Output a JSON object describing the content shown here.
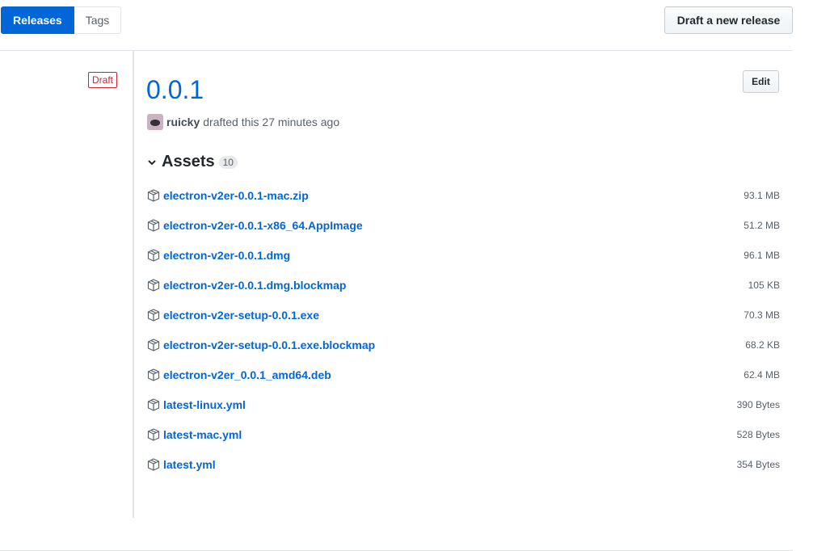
{
  "subnav": {
    "releases": "Releases",
    "tags": "Tags"
  },
  "actions": {
    "draft_new_release": "Draft a new release",
    "edit": "Edit"
  },
  "release": {
    "status_label": "Draft",
    "title": "0.0.1",
    "author": "ruicky",
    "meta_text": "drafted this 27 minutes ago"
  },
  "assets": {
    "title": "Assets",
    "count": "10",
    "items": [
      {
        "name": "electron-v2er-0.0.1-mac.zip",
        "size": "93.1 MB"
      },
      {
        "name": "electron-v2er-0.0.1-x86_64.AppImage",
        "size": "51.2 MB"
      },
      {
        "name": "electron-v2er-0.0.1.dmg",
        "size": "96.1 MB"
      },
      {
        "name": "electron-v2er-0.0.1.dmg.blockmap",
        "size": "105 KB"
      },
      {
        "name": "electron-v2er-setup-0.0.1.exe",
        "size": "70.3 MB"
      },
      {
        "name": "electron-v2er-setup-0.0.1.exe.blockmap",
        "size": "68.2 KB"
      },
      {
        "name": "electron-v2er_0.0.1_amd64.deb",
        "size": "62.4 MB"
      },
      {
        "name": "latest-linux.yml",
        "size": "390 Bytes"
      },
      {
        "name": "latest-mac.yml",
        "size": "528 Bytes"
      },
      {
        "name": "latest.yml",
        "size": "354 Bytes"
      }
    ]
  },
  "icons": {
    "asset": "package-icon",
    "assets_toggle": "chevron-down-icon"
  },
  "colors": {
    "accent": "#0366d6",
    "draft": "#cb2431"
  }
}
